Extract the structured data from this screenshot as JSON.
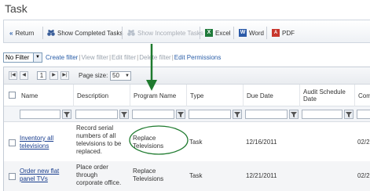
{
  "page": {
    "title": "Task"
  },
  "toolbar": {
    "return_label": "Return",
    "show_completed_label": "Show Completed Tasks",
    "show_incomplete_label": "Show Incomplete Tasks",
    "excel_label": "Excel",
    "word_label": "Word",
    "pdf_label": "PDF"
  },
  "filterbar": {
    "selected_filter": "No Filter",
    "create_filter": "Create filter",
    "view_filter": "View filter",
    "edit_filter": "Edit filter",
    "delete_filter": "Delete filter",
    "edit_permissions": "Edit Permissions",
    "separator": "|"
  },
  "pager": {
    "current_page": "1",
    "page_size_label": "Page size:",
    "page_size": "50"
  },
  "columns": [
    "Name",
    "Description",
    "Program Name",
    "Type",
    "Due Date",
    "Audit Schedule Date",
    "Com"
  ],
  "rows": [
    {
      "name": "Inventory all televisions",
      "description": "Record serial numbers of all televisions to be replaced.",
      "program": "Replace Televisions",
      "type": "Task",
      "due_date": "12/16/2011",
      "audit_date": "",
      "completed": "02/2"
    },
    {
      "name": "Order new flat panel TVs",
      "description": "Place order through corporate office.",
      "program": "Replace Televisions",
      "type": "Task",
      "due_date": "12/21/2011",
      "audit_date": "",
      "completed": "02/2"
    }
  ],
  "colors": {
    "link": "#1b3f8f",
    "annotation": "#1e7a2e",
    "toolbar_border": "#cfd6df"
  },
  "annotations": {
    "arrow_target": "Program Name",
    "highlight_target": "Replace Televisions"
  }
}
